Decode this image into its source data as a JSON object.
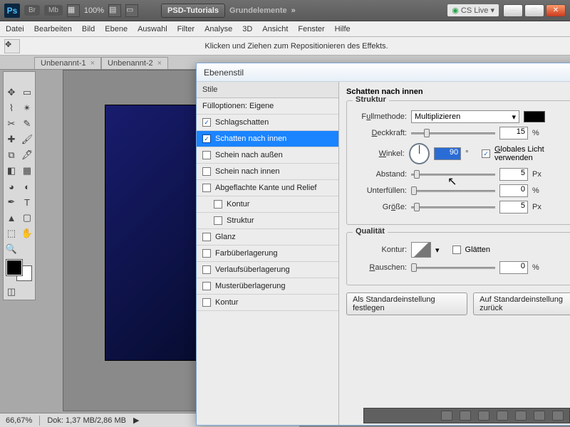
{
  "topbar": {
    "ps": "Ps",
    "br": "Br",
    "mb": "Mb",
    "zoom": "100%",
    "psd_btn": "PSD-Tutorials",
    "grund": "Grundelemente",
    "chev": "»",
    "cs": "CS Live ▾"
  },
  "menu": [
    "Datei",
    "Bearbeiten",
    "Bild",
    "Ebene",
    "Auswahl",
    "Filter",
    "Analyse",
    "3D",
    "Ansicht",
    "Fenster",
    "Hilfe"
  ],
  "opt_hint": "Klicken und Ziehen zum Repositionieren des Effekts.",
  "tabs": [
    {
      "name": "Unbenannt-1",
      "x": "×"
    },
    {
      "name": "Unbenannt-2",
      "x": "×"
    }
  ],
  "status": {
    "zoom": "66,67%",
    "doc": "Dok: 1,37 MB/2,86 MB"
  },
  "dlg": {
    "title": "Ebenenstil",
    "styles_hdr": "Stile",
    "fill_opts": "Fülloptionen: Eigene",
    "items": [
      {
        "cb": "✓",
        "t": "Schlagschatten"
      },
      {
        "cb": "✓",
        "t": "Schatten nach innen",
        "sel": true
      },
      {
        "cb": "",
        "t": "Schein nach außen"
      },
      {
        "cb": "",
        "t": "Schein nach innen"
      },
      {
        "cb": "",
        "t": "Abgeflachte Kante und Relief"
      },
      {
        "cb": "",
        "t": "Kontur",
        "indent": true
      },
      {
        "cb": "",
        "t": "Struktur",
        "indent": true
      },
      {
        "cb": "",
        "t": "Glanz"
      },
      {
        "cb": "",
        "t": "Farbüberlagerung"
      },
      {
        "cb": "",
        "t": "Verlaufsüberlagerung"
      },
      {
        "cb": "",
        "t": "Musterüberlagerung"
      },
      {
        "cb": "",
        "t": "Kontur"
      }
    ],
    "section": "Schatten nach innen",
    "struktur": "Struktur",
    "fullmethode": "Füllmethode:",
    "fullmethode_u": "u",
    "blend_val": "Multiplizieren",
    "deckkraft": "Deckkraft:",
    "deckkraft_u": "D",
    "deckkraft_val": "15",
    "winkel": "Winkel:",
    "winkel_u": "W",
    "winkel_val": "90",
    "deg": "°",
    "global": "Globales Licht verwenden",
    "global_u": "G",
    "abstand": "Abstand:",
    "abstand_val": "5",
    "unterfullen": "Unterfüllen:",
    "unterfullen_val": "0",
    "grosse": "Größe:",
    "grosse_u": "ö",
    "grosse_val": "5",
    "pct": "%",
    "px": "Px",
    "qualitat": "Qualität",
    "kontur": "Kontur:",
    "glatten": "Glätten",
    "rauschen": "Rauschen:",
    "rauschen_u": "R",
    "rauschen_val": "0",
    "btn1": "Als Standardeinstellung festlegen",
    "btn2": "Auf Standardeinstellung zurück"
  }
}
